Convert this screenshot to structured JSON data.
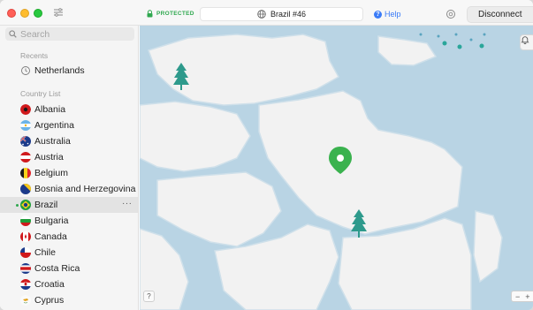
{
  "titlebar": {
    "status": "PROTECTED",
    "server": "Brazil #46",
    "help": "Help",
    "disconnect": "Disconnect"
  },
  "sidebar": {
    "search_placeholder": "Search",
    "recents_title": "Recents",
    "recents": [
      {
        "label": "Netherlands",
        "icon": "clock-icon"
      }
    ],
    "countries_title": "Country List",
    "countries": [
      {
        "label": "Albania",
        "flag": "flag-albania-icon"
      },
      {
        "label": "Argentina",
        "flag": "flag-argentina-icon"
      },
      {
        "label": "Australia",
        "flag": "flag-australia-icon"
      },
      {
        "label": "Austria",
        "flag": "flag-austria-icon"
      },
      {
        "label": "Belgium",
        "flag": "flag-belgium-icon"
      },
      {
        "label": "Bosnia and Herzegovina",
        "flag": "flag-bosnia-icon"
      },
      {
        "label": "Brazil",
        "flag": "flag-brazil-icon",
        "selected": true,
        "more": "···"
      },
      {
        "label": "Bulgaria",
        "flag": "flag-bulgaria-icon"
      },
      {
        "label": "Canada",
        "flag": "flag-canada-icon"
      },
      {
        "label": "Chile",
        "flag": "flag-chile-icon"
      },
      {
        "label": "Costa Rica",
        "flag": "flag-costa-rica-icon"
      },
      {
        "label": "Croatia",
        "flag": "flag-croatia-icon"
      },
      {
        "label": "Cyprus",
        "flag": "flag-cyprus-icon"
      }
    ]
  },
  "map": {
    "help_button": "?",
    "zoom_out": "−",
    "zoom_in": "+"
  },
  "colors": {
    "protected_green": "#2fa84f",
    "link_blue": "#3a7bf7",
    "water": "#b9d4e4",
    "land": "#f2f2f2",
    "pin": "#3ab24e",
    "tree": "#2e9a8c"
  }
}
